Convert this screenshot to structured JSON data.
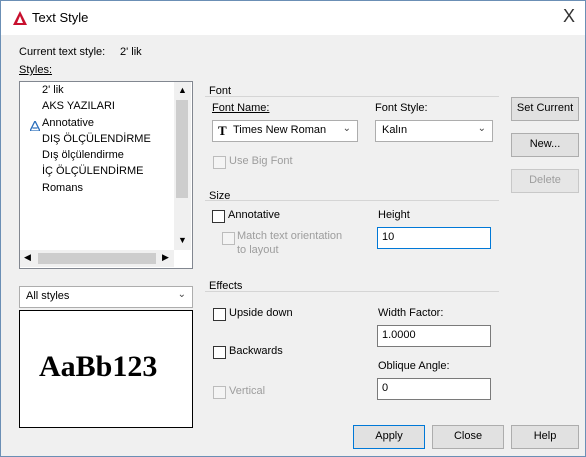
{
  "window": {
    "title": "Text Style",
    "close_glyph": "X",
    "app_icon": "autocad-logo-icon"
  },
  "current_style": {
    "label": "Current text style:",
    "value": "2' lik"
  },
  "styles": {
    "label": "Styles:",
    "items": [
      "2' lik",
      "AKS YAZILARI",
      "Annotative",
      "DIŞ ÖLÇÜLENDİRME",
      "Dış ölçülendirme",
      "İÇ ÖLÇÜLENDİRME",
      "Romans"
    ],
    "filter_value": "All styles"
  },
  "preview": {
    "text": "AaBb123"
  },
  "font": {
    "group_label": "Font",
    "name_label": "Font Name:",
    "name_value": "Times New Roman",
    "font_icon": "truetype-font-icon",
    "style_label": "Font Style:",
    "style_value": "Kalın",
    "big_font_label": "Use Big Font"
  },
  "size": {
    "group_label": "Size",
    "annotative_label": "Annotative",
    "match_label_1": "Match text orientation",
    "match_label_2": "to layout",
    "height_label": "Height",
    "height_value": "10"
  },
  "effects": {
    "group_label": "Effects",
    "upside_down_label": "Upside down",
    "backwards_label": "Backwards",
    "vertical_label": "Vertical",
    "width_factor_label": "Width Factor:",
    "width_factor_value": "1.0000",
    "oblique_label": "Oblique Angle:",
    "oblique_value": "0"
  },
  "buttons": {
    "set_current": "Set Current",
    "new": "New...",
    "delete": "Delete",
    "apply": "Apply",
    "close": "Close",
    "help": "Help"
  },
  "colors": {
    "accent": "#0078d7",
    "autocad_red": "#c8102e"
  }
}
